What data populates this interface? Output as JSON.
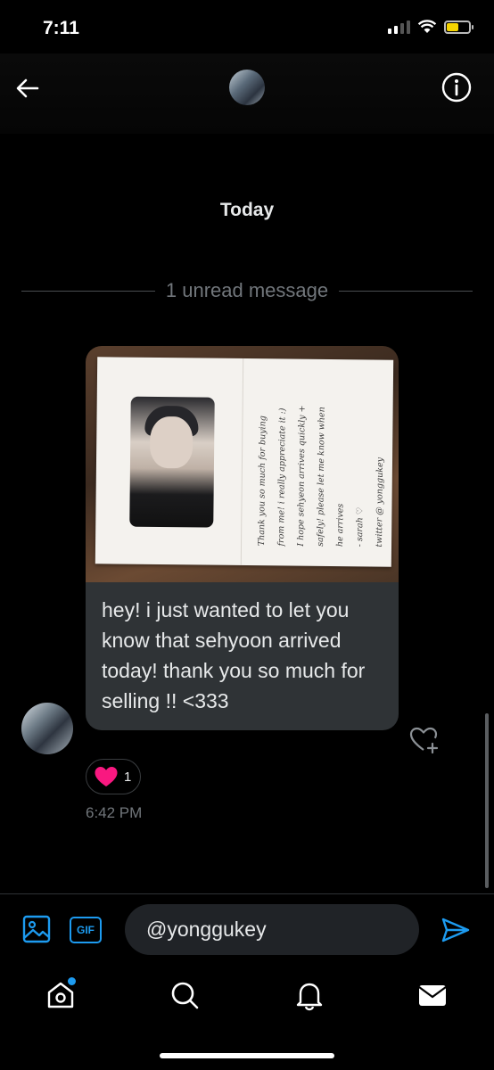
{
  "status_bar": {
    "time": "7:11",
    "icons": [
      "cellular-signal-icon",
      "wifi-icon",
      "battery-icon"
    ],
    "battery_color": "#f5d400"
  },
  "header": {
    "back_icon": "arrow-left-icon",
    "info_icon": "info-icon"
  },
  "conversation": {
    "date_label": "Today",
    "unread_divider": "1 unread message"
  },
  "message": {
    "image_note_lines": [
      "Thank you so much for buying",
      "from me! i really appreciate it :)",
      "",
      "I hope sehyeon arrives quickly +",
      "safely! please let me know when",
      "he arrives",
      "",
      "- sarah ♡",
      "twitter @ yonggukey"
    ],
    "text": "hey! i just wanted to let you know that sehyoon arrived today! thank you so much for selling !! <333",
    "reaction_emoji": "heart-icon",
    "reaction_count": "1",
    "timestamp": "6:42 PM"
  },
  "composer": {
    "image_icon": "image-icon",
    "gif_label": "GIF",
    "input_value": "@yonggukey",
    "send_icon": "send-icon"
  },
  "nav": {
    "items": [
      "home-icon",
      "search-icon",
      "notifications-icon",
      "messages-icon"
    ]
  },
  "colors": {
    "accent": "#1d9bf0",
    "bubble": "#2f3336",
    "heart": "#f91880",
    "muted_text": "#71767b"
  }
}
